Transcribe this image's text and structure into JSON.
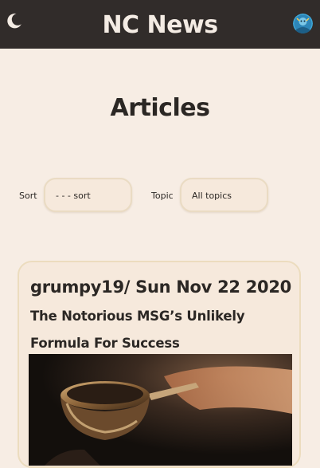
{
  "header": {
    "brand": "NC News",
    "theme_toggle_icon": "moon-icon",
    "avatar_icon": "user-avatar",
    "bg_color": "#312c2a",
    "text_color": "#f4ece4"
  },
  "main": {
    "title": "Articles",
    "bg_color": "#f7ede4"
  },
  "controls": {
    "sort_label": "Sort",
    "sort_value": "- - - sort",
    "topic_label": "Topic",
    "topic_value": "All topics"
  },
  "articles": [
    {
      "author_date": "grumpy19/ Sun Nov 22 2020",
      "title": "The Notorious MSG’s Unlikely Formula For Success",
      "image_subject": "hand-holding-pan-image"
    }
  ]
}
